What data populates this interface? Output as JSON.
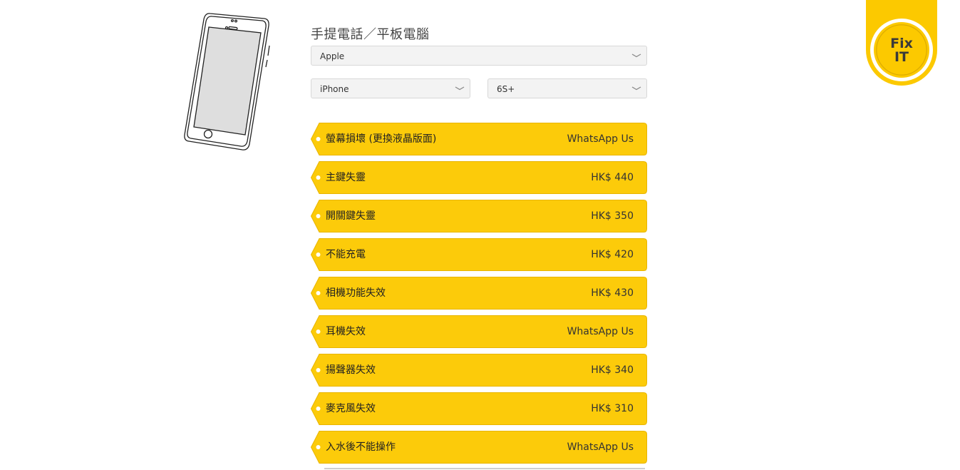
{
  "heading": "手提電話／平板電腦",
  "selects": {
    "brand": "Apple",
    "type": "iPhone",
    "model": "6S+"
  },
  "repairs": [
    {
      "name": "螢幕損壞 (更換液晶版面)",
      "price": "WhatsApp Us"
    },
    {
      "name": "主鍵失靈",
      "price": "HK$ 440"
    },
    {
      "name": "開關鍵失靈",
      "price": "HK$ 350"
    },
    {
      "name": "不能充電",
      "price": "HK$ 420"
    },
    {
      "name": "相機功能失效",
      "price": "HK$ 430"
    },
    {
      "name": "耳機失效",
      "price": "WhatsApp Us"
    },
    {
      "name": "揚聲器失效",
      "price": "HK$ 340"
    },
    {
      "name": "麥克風失效",
      "price": "HK$ 310"
    },
    {
      "name": "入水後不能操作",
      "price": "WhatsApp Us"
    }
  ],
  "badge": {
    "line1": "Fix",
    "line2": "IT"
  },
  "colors": {
    "tag": "#fccb0a",
    "badge_yellow": "#fcc900",
    "badge_gold": "#e8b800"
  },
  "icons": {
    "phone": "phone-illustration-icon",
    "chevron": "chevron-down-icon",
    "logo": "fix-it-logo-icon"
  }
}
